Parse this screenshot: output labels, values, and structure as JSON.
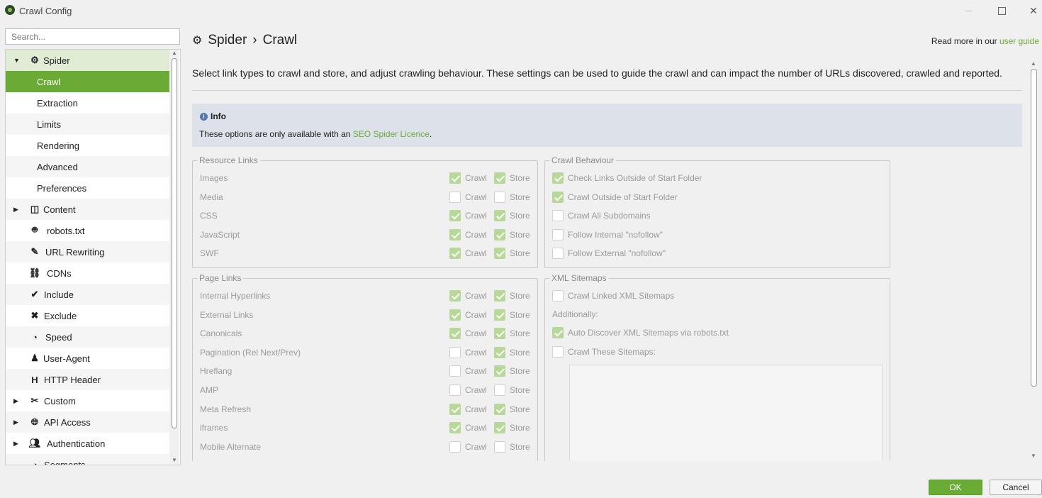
{
  "window": {
    "title": "Crawl Config"
  },
  "search": {
    "placeholder": "Search..."
  },
  "sidebar": {
    "items": [
      {
        "label": "Spider",
        "level": 0,
        "expanded": true,
        "icon": "gear-icon"
      },
      {
        "label": "Crawl",
        "level": 1,
        "selected": true
      },
      {
        "label": "Extraction",
        "level": 1
      },
      {
        "label": "Limits",
        "level": 1
      },
      {
        "label": "Rendering",
        "level": 1
      },
      {
        "label": "Advanced",
        "level": 1
      },
      {
        "label": "Preferences",
        "level": 1
      },
      {
        "label": "Content",
        "level": 0,
        "collapsed": true,
        "icon": "columns-icon"
      },
      {
        "label": "robots.txt",
        "level": 0,
        "icon": "robot-icon"
      },
      {
        "label": "URL Rewriting",
        "level": 0,
        "icon": "edit-icon"
      },
      {
        "label": "CDNs",
        "level": 0,
        "icon": "network-icon"
      },
      {
        "label": "Include",
        "level": 0,
        "icon": "check-circle-icon"
      },
      {
        "label": "Exclude",
        "level": 0,
        "icon": "x-circle-icon"
      },
      {
        "label": "Speed",
        "level": 0,
        "icon": "speedometer-icon"
      },
      {
        "label": "User-Agent",
        "level": 0,
        "icon": "user-secret-icon"
      },
      {
        "label": "HTTP Header",
        "level": 0,
        "icon": "header-icon"
      },
      {
        "label": "Custom",
        "level": 0,
        "collapsed": true,
        "icon": "tools-icon"
      },
      {
        "label": "API Access",
        "level": 0,
        "collapsed": true,
        "icon": "globe-icon"
      },
      {
        "label": "Authentication",
        "level": 0,
        "collapsed": true,
        "icon": "user-lock-icon"
      },
      {
        "label": "Segments",
        "level": 0,
        "icon": "pie-icon"
      }
    ]
  },
  "header": {
    "breadcrumb_parent": "Spider",
    "breadcrumb_sep": "›",
    "breadcrumb_current": "Crawl",
    "readmore_prefix": "Read more in our ",
    "readmore_link": "user guide"
  },
  "description": "Select link types to crawl and store, and adjust crawling behaviour. These settings can be used to guide the crawl and can impact the number of URLs discovered, crawled and reported.",
  "info": {
    "title": "Info",
    "text_prefix": "These options are only available with an ",
    "link": "SEO Spider Licence",
    "text_suffix": "."
  },
  "resource_links": {
    "title": "Resource Links",
    "crawl_label": "Crawl",
    "store_label": "Store",
    "rows": [
      {
        "label": "Images",
        "crawl": true,
        "store": true
      },
      {
        "label": "Media",
        "crawl": false,
        "store": false
      },
      {
        "label": "CSS",
        "crawl": true,
        "store": true
      },
      {
        "label": "JavaScript",
        "crawl": true,
        "store": true
      },
      {
        "label": "SWF",
        "crawl": true,
        "store": true
      }
    ]
  },
  "page_links": {
    "title": "Page Links",
    "crawl_label": "Crawl",
    "store_label": "Store",
    "rows": [
      {
        "label": "Internal Hyperlinks",
        "crawl": true,
        "store": true
      },
      {
        "label": "External Links",
        "crawl": true,
        "store": true
      },
      {
        "label": "Canonicals",
        "crawl": true,
        "store": true
      },
      {
        "label": "Pagination (Rel Next/Prev)",
        "crawl": false,
        "store": true
      },
      {
        "label": "Hreflang",
        "crawl": false,
        "store": true
      },
      {
        "label": "AMP",
        "crawl": false,
        "store": false
      },
      {
        "label": "Meta Refresh",
        "crawl": true,
        "store": true
      },
      {
        "label": "iframes",
        "crawl": true,
        "store": true
      },
      {
        "label": "Mobile Alternate",
        "crawl": false,
        "store": false
      }
    ]
  },
  "crawl_behaviour": {
    "title": "Crawl Behaviour",
    "rows": [
      {
        "label": "Check Links Outside of Start Folder",
        "checked": true
      },
      {
        "label": "Crawl Outside of Start Folder",
        "checked": true
      },
      {
        "label": "Crawl All Subdomains",
        "checked": false
      },
      {
        "label": "Follow Internal \"nofollow\"",
        "checked": false
      },
      {
        "label": "Follow External \"nofollow\"",
        "checked": false
      }
    ]
  },
  "xml_sitemaps": {
    "title": "XML Sitemaps",
    "crawl_linked": {
      "label": "Crawl Linked XML Sitemaps",
      "checked": false
    },
    "additionally": "Additionally:",
    "auto_discover": {
      "label": "Auto Discover XML Sitemaps via robots.txt",
      "checked": true
    },
    "crawl_these": {
      "label": "Crawl These Sitemaps:",
      "checked": false
    }
  },
  "footer": {
    "ok": "OK",
    "cancel": "Cancel"
  }
}
